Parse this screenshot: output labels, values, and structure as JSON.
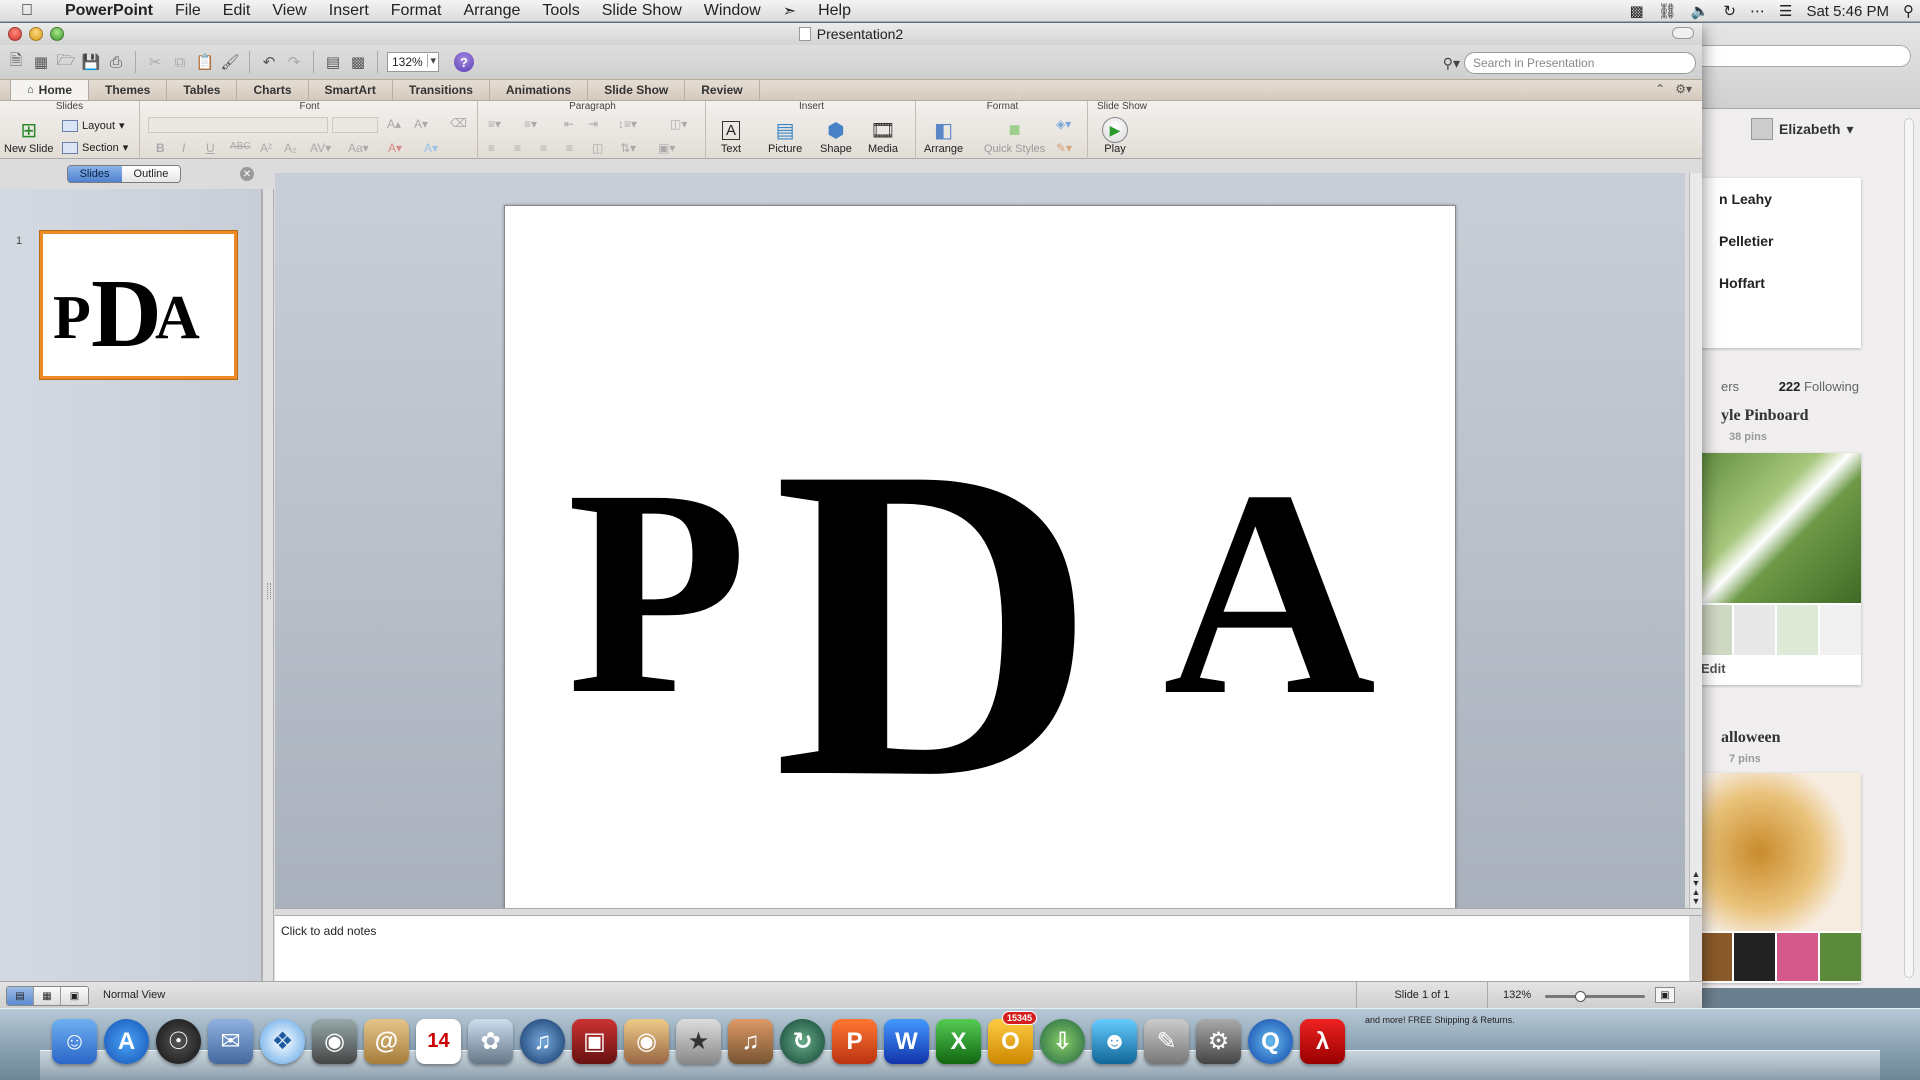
{
  "menubar": {
    "apple": "",
    "app_name": "PowerPoint",
    "items": [
      "File",
      "Edit",
      "View",
      "Insert",
      "Format",
      "Arrange",
      "Tools",
      "Slide Show",
      "Window",
      "",
      "Help"
    ],
    "clock": "Sat 5:46 PM"
  },
  "window": {
    "title": "Presentation2",
    "zoom": "132%",
    "search_placeholder": "Search in Presentation"
  },
  "tabs": [
    "Home",
    "Themes",
    "Tables",
    "Charts",
    "SmartArt",
    "Transitions",
    "Animations",
    "Slide Show",
    "Review"
  ],
  "ribbon": {
    "groups": {
      "slides": "Slides",
      "font": "Font",
      "paragraph": "Paragraph",
      "insert": "Insert",
      "format": "Format",
      "slideshow": "Slide Show"
    },
    "new_slide": "New Slide",
    "layout": "Layout",
    "section": "Section",
    "text": "Text",
    "picture": "Picture",
    "shape": "Shape",
    "media": "Media",
    "arrange": "Arrange",
    "quick_styles": "Quick Styles",
    "play": "Play"
  },
  "panel": {
    "tab_slides": "Slides",
    "tab_outline": "Outline",
    "slide_number": "1"
  },
  "slide": {
    "letter1": "P",
    "letter2": "D",
    "letter3": "A"
  },
  "notes": {
    "placeholder": "Click to add notes"
  },
  "status": {
    "view": "Normal View",
    "slide_of": "Slide 1 of 1",
    "zoom": "132%"
  },
  "background_window": {
    "user": "Elizabeth",
    "people": [
      "n Leahy",
      "Pelletier",
      "Hoffart"
    ],
    "followers_label": "ers",
    "following_count": "222",
    "following_label": "Following",
    "board1_title": "yle Pinboard",
    "board1_pins": "38 pins",
    "edit": "Edit",
    "board2_title": "alloween",
    "board2_pins": "7 pins"
  },
  "dock": {
    "calendar_day": "14",
    "mail_badge": "15345",
    "note_text": "and more! FREE Shipping & Returns."
  },
  "colors": {
    "thumb_selection": "#ee8a25",
    "ribbon_tab_bg": "#d6cabe",
    "canvas_bg": "#a9b1bd"
  }
}
